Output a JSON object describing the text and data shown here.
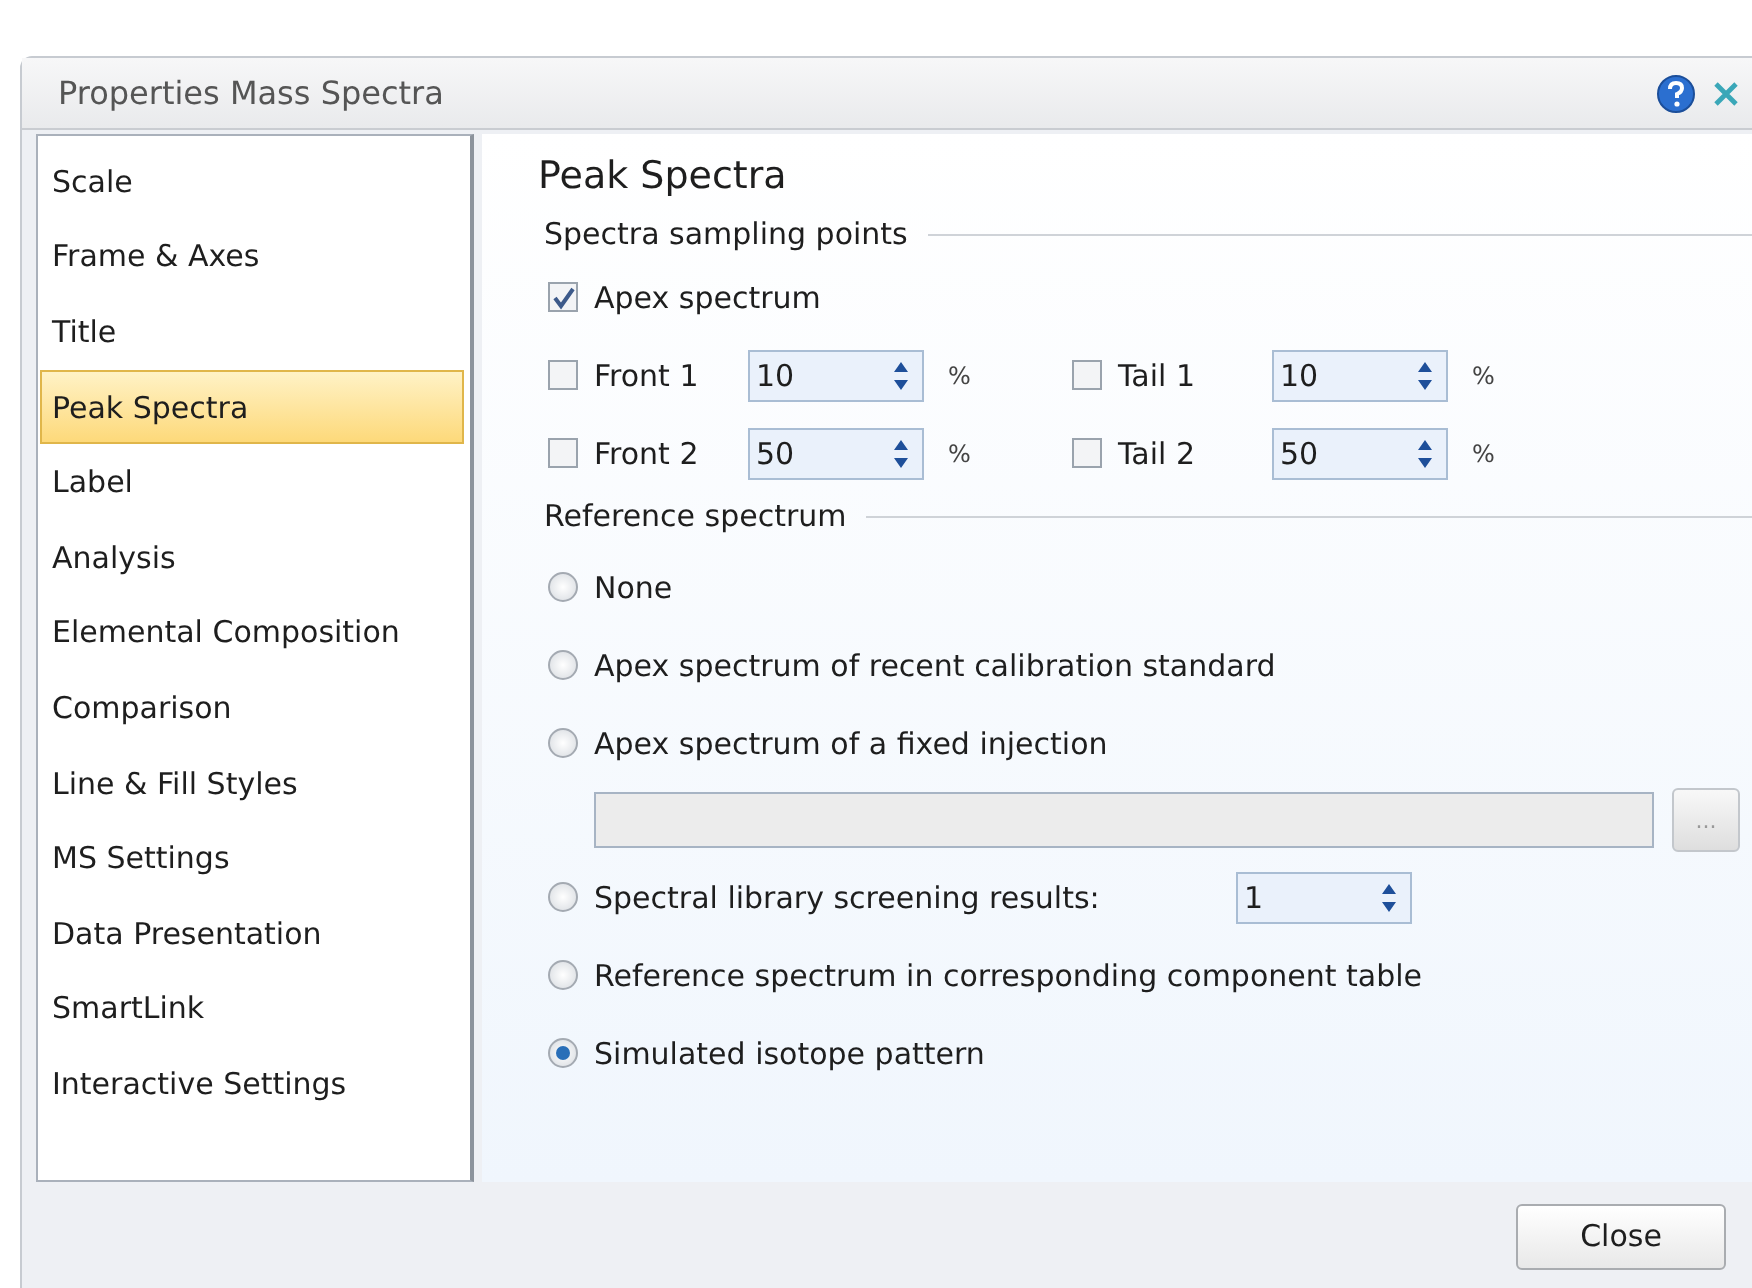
{
  "window": {
    "title": "Properties Mass Spectra"
  },
  "sidebar": {
    "items": [
      {
        "label": "Scale",
        "selected": false
      },
      {
        "label": "Frame & Axes",
        "selected": false
      },
      {
        "label": "Title",
        "selected": false
      },
      {
        "label": "Peak Spectra",
        "selected": true
      },
      {
        "label": "Label",
        "selected": false
      },
      {
        "label": "Analysis",
        "selected": false
      },
      {
        "label": "Elemental Composition",
        "selected": false
      },
      {
        "label": "Comparison",
        "selected": false
      },
      {
        "label": "Line & Fill Styles",
        "selected": false
      },
      {
        "label": "MS Settings",
        "selected": false
      },
      {
        "label": "Data Presentation",
        "selected": false
      },
      {
        "label": "SmartLink",
        "selected": false
      },
      {
        "label": "Interactive Settings",
        "selected": false
      }
    ]
  },
  "page": {
    "heading": "Peak Spectra",
    "sampling": {
      "title": "Spectra sampling points",
      "apex": {
        "label": "Apex spectrum",
        "checked": true
      },
      "rows": [
        {
          "left": {
            "label": "Front 1",
            "checked": false,
            "value": "10",
            "unit": "%"
          },
          "right": {
            "label": "Tail 1",
            "checked": false,
            "value": "10",
            "unit": "%"
          }
        },
        {
          "left": {
            "label": "Front 2",
            "checked": false,
            "value": "50",
            "unit": "%"
          },
          "right": {
            "label": "Tail 2",
            "checked": false,
            "value": "50",
            "unit": "%"
          }
        }
      ]
    },
    "reference": {
      "title": "Reference spectrum",
      "options": [
        {
          "kind": "plain",
          "label": "None",
          "selected": false
        },
        {
          "kind": "plain",
          "label": "Apex spectrum of recent calibration standard",
          "selected": false
        },
        {
          "kind": "path",
          "label": "Apex spectrum of a fixed injection",
          "selected": false,
          "browse": "..."
        },
        {
          "kind": "spinner",
          "label": "Spectral library screening results:",
          "selected": false,
          "value": "1"
        },
        {
          "kind": "plain",
          "label": "Reference spectrum in corresponding component table",
          "selected": false
        },
        {
          "kind": "plain",
          "label": "Simulated isotope pattern",
          "selected": true
        }
      ]
    }
  },
  "footer": {
    "close": "Close"
  }
}
